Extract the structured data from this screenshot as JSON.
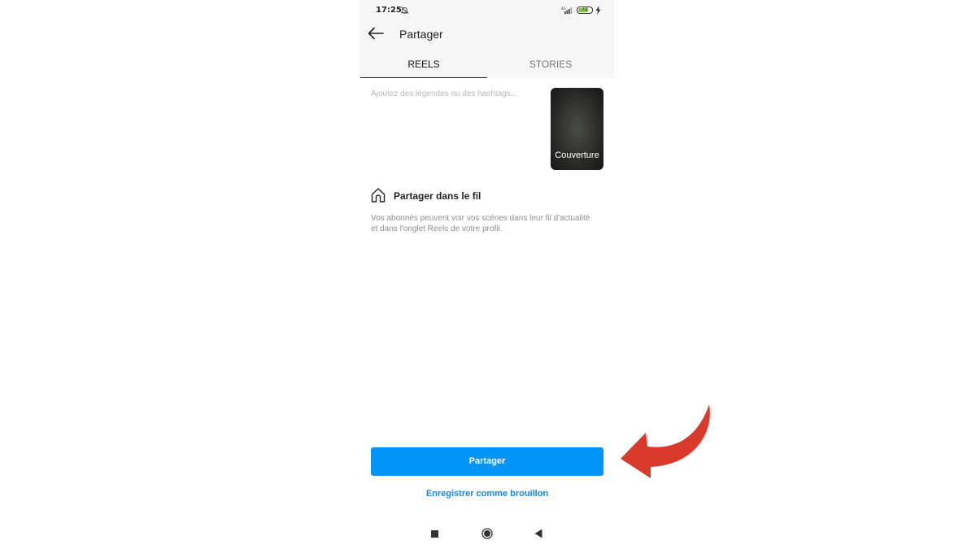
{
  "status_bar": {
    "time": "17:25",
    "battery_level": "72",
    "battery_fraction": 0.72,
    "icons": [
      "bell-muted-icon",
      "signal-icon",
      "battery-icon",
      "charging-icon"
    ]
  },
  "header": {
    "title": "Partager",
    "back_icon": "arrow-left-icon"
  },
  "tabs": [
    {
      "label": "REELS",
      "active": true
    },
    {
      "label": "STORIES",
      "active": false
    }
  ],
  "caption": {
    "placeholder": "Ajoutez des légendes ou des hashtags..."
  },
  "cover": {
    "label": "Couverture"
  },
  "feed_option": {
    "icon": "home-icon",
    "title": "Partager dans le fil",
    "description": "Vos abonnés peuvent voir vos scènes dans leur fil d'actualité et dans l'onglet Reels de votre profil."
  },
  "actions": {
    "share_label": "Partager",
    "draft_label": "Enregistrer comme brouillon"
  },
  "nav_bar": {
    "icons": [
      "square-recents-icon",
      "circle-home-icon",
      "triangle-back-icon"
    ]
  },
  "colors": {
    "primary_button": "#0095f6",
    "link": "#1a87d6",
    "annotation_arrow": "#d93a2b",
    "battery_fill": "#7cc93b"
  }
}
